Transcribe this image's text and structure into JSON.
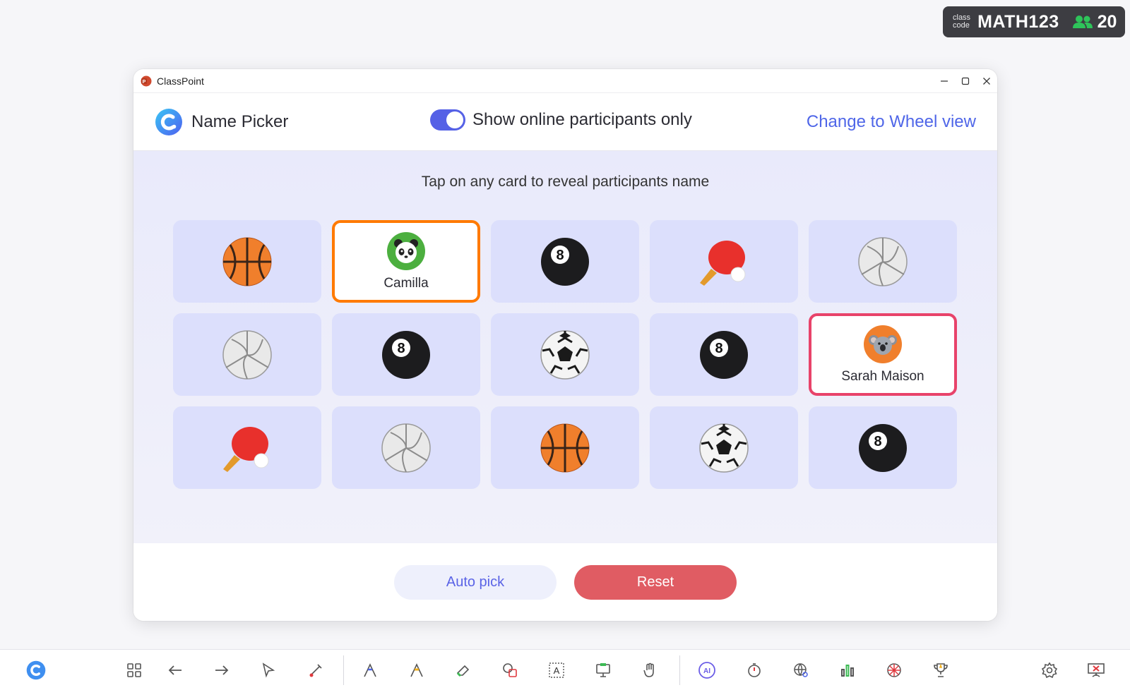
{
  "class_badge": {
    "label_line1": "class",
    "label_line2": "code",
    "code": "MATH123",
    "participants": "20"
  },
  "window": {
    "app_title": "ClassPoint",
    "header_title": "Name Picker",
    "toggle_label": "Show online participants only",
    "toggle_on": true,
    "switch_view_link": "Change to Wheel view",
    "instruction": "Tap on any card to reveal participants name"
  },
  "cards": [
    {
      "icon": "basketball-icon"
    },
    {
      "icon": "panda-avatar",
      "name": "Camilla",
      "revealed": true,
      "border": "#ff7a00"
    },
    {
      "icon": "eight-ball-icon"
    },
    {
      "icon": "ping-pong-icon"
    },
    {
      "icon": "volleyball-icon"
    },
    {
      "icon": "volleyball-icon"
    },
    {
      "icon": "eight-ball-icon"
    },
    {
      "icon": "soccer-ball-icon"
    },
    {
      "icon": "eight-ball-icon"
    },
    {
      "icon": "koala-avatar",
      "name": "Sarah Maison",
      "revealed": true,
      "border": "#e8436a"
    },
    {
      "icon": "ping-pong-icon"
    },
    {
      "icon": "volleyball-icon"
    },
    {
      "icon": "basketball-icon"
    },
    {
      "icon": "soccer-ball-icon"
    },
    {
      "icon": "eight-ball-icon"
    }
  ],
  "buttons": {
    "auto_pick": "Auto pick",
    "reset": "Reset"
  },
  "toolbar_icons": [
    "classpoint-logo-icon",
    "slides-grid-icon",
    "previous-arrow-icon",
    "next-arrow-icon",
    "pointer-icon",
    "laser-pen-icon",
    "pen-icon",
    "highlighter-icon",
    "eraser-icon",
    "shapes-icon",
    "text-box-icon",
    "whiteboard-icon",
    "drag-objects-icon",
    "ai-quiz-icon",
    "timer-icon",
    "web-search-icon",
    "quiz-results-icon",
    "name-picker-wheel-icon",
    "leaderboard-icon",
    "settings-icon",
    "end-show-icon"
  ],
  "colors": {
    "accent": "#5561e6",
    "link": "#4f66e8",
    "reset": "#e05c63",
    "card": "#dcdffc"
  }
}
